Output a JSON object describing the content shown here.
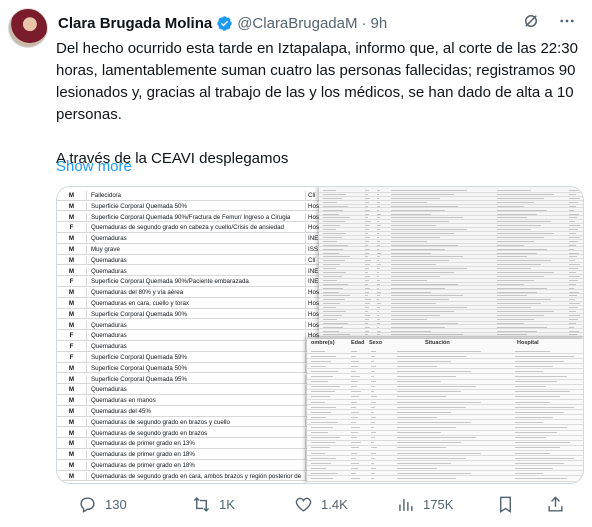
{
  "author": {
    "name": "Clara Brugada Molina",
    "handle": "@ClaraBrugadaM",
    "separator": "·",
    "time": "9h"
  },
  "tweet": {
    "paragraphs": [
      "Del hecho ocurrido esta tarde en Iztapalapa, informo que, al corte de las 22:30 horas, lamentablemente suman cuatro las personas fallecidas; registramos 90 lesionados y, gracias al trabajo de las y los médicos, se han dado de alta a 10 personas.",
      "A través de la CEAVI desplegamos"
    ],
    "show_more": "Show more"
  },
  "media": {
    "left_sheet_rows": [
      {
        "sex": "M",
        "desc": "Fallecido/a",
        "col": "Clí"
      },
      {
        "sex": "M",
        "desc": "Superficie Corporal Quemada 50%",
        "col": "Hos"
      },
      {
        "sex": "M",
        "desc": "Superficie Corporal Quemada 90%/Fractura de Femur/ Ingreso a Cirugia",
        "col": "Hos"
      },
      {
        "sex": "F",
        "desc": "Quemaduras de segundo grado en cabeza y cuello/Crisis de ansiedad",
        "col": "Hos"
      },
      {
        "sex": "M",
        "desc": "Quemaduras",
        "col": "INE"
      },
      {
        "sex": "M",
        "desc": "Muy grave",
        "col": "ISS"
      },
      {
        "sex": "M",
        "desc": "Quemaduras",
        "col": "Clí"
      },
      {
        "sex": "M",
        "desc": "Quemaduras",
        "col": "INE"
      },
      {
        "sex": "F",
        "desc": "Superficie Corporal Quemada 90%/Paciente embarazada",
        "col": "INE"
      },
      {
        "sex": "M",
        "desc": "Quemaduras del 80% y vía aérea",
        "col": "Hos"
      },
      {
        "sex": "M",
        "desc": "Quemaduras en cara, cuello y torax",
        "col": "Hos"
      },
      {
        "sex": "M",
        "desc": "Superficie Corporal Quemada 90%",
        "col": "Hos"
      },
      {
        "sex": "M",
        "desc": "Quemaduras",
        "col": "Hos"
      },
      {
        "sex": "F",
        "desc": "Quemaduras",
        "col": "Hos"
      },
      {
        "sex": "F",
        "desc": "Quemaduras",
        "col": "Hos"
      },
      {
        "sex": "F",
        "desc": "Superficie Corporal Quemada 59%",
        "col": "Hos"
      },
      {
        "sex": "M",
        "desc": "Superficie Corporal Quemada 50%",
        "col": "Hos"
      },
      {
        "sex": "M",
        "desc": "Superficie Corporal Quemada 95%",
        "col": "Hos"
      },
      {
        "sex": "M",
        "desc": "Quemaduras",
        "col": "Hos"
      },
      {
        "sex": "M",
        "desc": "Quemaduras en manos",
        "col": "Hos"
      },
      {
        "sex": "M",
        "desc": "Quemaduras del 45%",
        "col": "Clí"
      },
      {
        "sex": "M",
        "desc": "Quemaduras de segundo grado en brazos y cuello",
        "col": "Hos"
      },
      {
        "sex": "M",
        "desc": "Quemaduras de segundo grado en brazos",
        "col": "Hos"
      },
      {
        "sex": "M",
        "desc": "Quemaduras de primer grado en 13%",
        "col": "Hos"
      },
      {
        "sex": "M",
        "desc": "Quemaduras de primer grado en 18%",
        "col": "Uni"
      },
      {
        "sex": "M",
        "desc": "Quemaduras de primer grado en 18%",
        "col": "Uni"
      },
      {
        "sex": "M",
        "desc": "Quemaduras de segundo grado en cara, ambos brazos y región posterior de pierna",
        "col": "Hos"
      }
    ],
    "bottom_sheet_headers": [
      "ombre(s)",
      "Edad",
      "Sexo",
      "Situación",
      "Hospital"
    ]
  },
  "actions": {
    "replies": "130",
    "reposts": "1K",
    "likes": "1.4K",
    "views": "175K"
  },
  "colors": {
    "text": "#0f1419",
    "muted": "#536471",
    "link": "#1d9bf0",
    "verified": "#1d9bf0",
    "border": "#cfd9de"
  }
}
